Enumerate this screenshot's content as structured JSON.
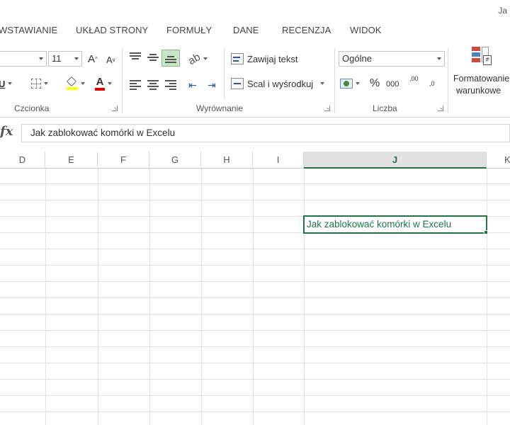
{
  "window": {
    "title_fragment": "Ja"
  },
  "tabs": [
    {
      "label": "WSTAWIANIE"
    },
    {
      "label": "UKŁAD STRONY"
    },
    {
      "label": "FORMUŁY"
    },
    {
      "label": "DANE"
    },
    {
      "label": "RECENZJA"
    },
    {
      "label": "WIDOK"
    }
  ],
  "ribbon": {
    "font_group": {
      "label": "Czcionka",
      "font_size_value": "11",
      "grow_font_label": "A",
      "shrink_font_label": "A",
      "underline_label": "U",
      "font_color_label": "A",
      "highlight_color": "#ffff00",
      "font_color": "#e00000"
    },
    "alignment_group": {
      "label": "Wyrównanie",
      "wrap_text_label": "Zawijaj tekst",
      "merge_center_label": "Scal i wyśrodkuj"
    },
    "number_group": {
      "label": "Liczba",
      "format_value": "Ogólne",
      "percent_label": "%",
      "thousands_label": "000",
      "increase_decimal_label": ",00",
      "decrease_decimal_label": ",0"
    },
    "styles_group": {
      "conditional_line1": "Formatowanie",
      "conditional_line2": "warunkowe"
    }
  },
  "formula_bar": {
    "fx_label": "fx",
    "value": "Jak zablokować komórki w Excelu"
  },
  "columns": [
    "D",
    "E",
    "F",
    "G",
    "H",
    "I",
    "J",
    "K"
  ],
  "active_column": "J",
  "active_cell": {
    "value": "Jak zablokować komórki w Excelu"
  },
  "colors": {
    "excel_green": "#217346",
    "grid_line": "#e0e0e0"
  }
}
